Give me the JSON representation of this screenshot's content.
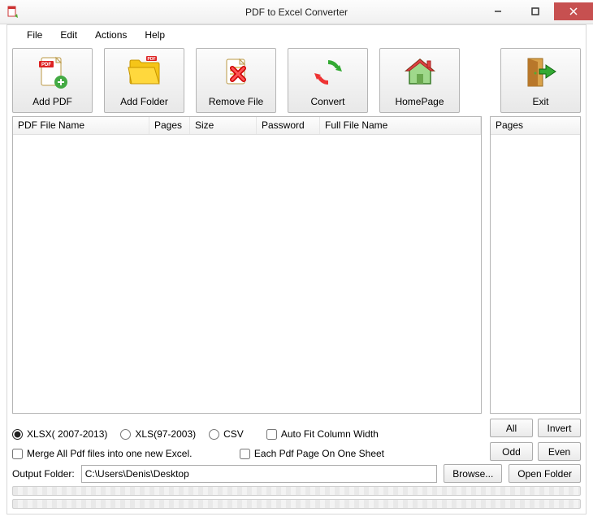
{
  "window": {
    "title": "PDF to Excel Converter"
  },
  "menu": {
    "file": "File",
    "edit": "Edit",
    "actions": "Actions",
    "help": "Help"
  },
  "toolbar": {
    "add_pdf": "Add PDF",
    "add_folder": "Add Folder",
    "remove_file": "Remove File",
    "convert": "Convert",
    "homepage": "HomePage",
    "exit": "Exit"
  },
  "columns": {
    "file_name": "PDF File Name",
    "pages": "Pages",
    "size": "Size",
    "password": "Password",
    "full_name": "Full File Name",
    "side_pages": "Pages"
  },
  "format": {
    "xlsx": "XLSX( 2007-2013)",
    "xls": "XLS(97-2003)",
    "csv": "CSV",
    "autofit": "Auto Fit Column Width",
    "merge": "Merge All Pdf files into one new Excel.",
    "each_page": "Each Pdf Page On One Sheet"
  },
  "buttons": {
    "all": "All",
    "invert": "Invert",
    "odd": "Odd",
    "even": "Even",
    "browse": "Browse...",
    "open_folder": "Open Folder"
  },
  "output": {
    "label": "Output Folder:",
    "path": "C:\\Users\\Denis\\Desktop"
  }
}
